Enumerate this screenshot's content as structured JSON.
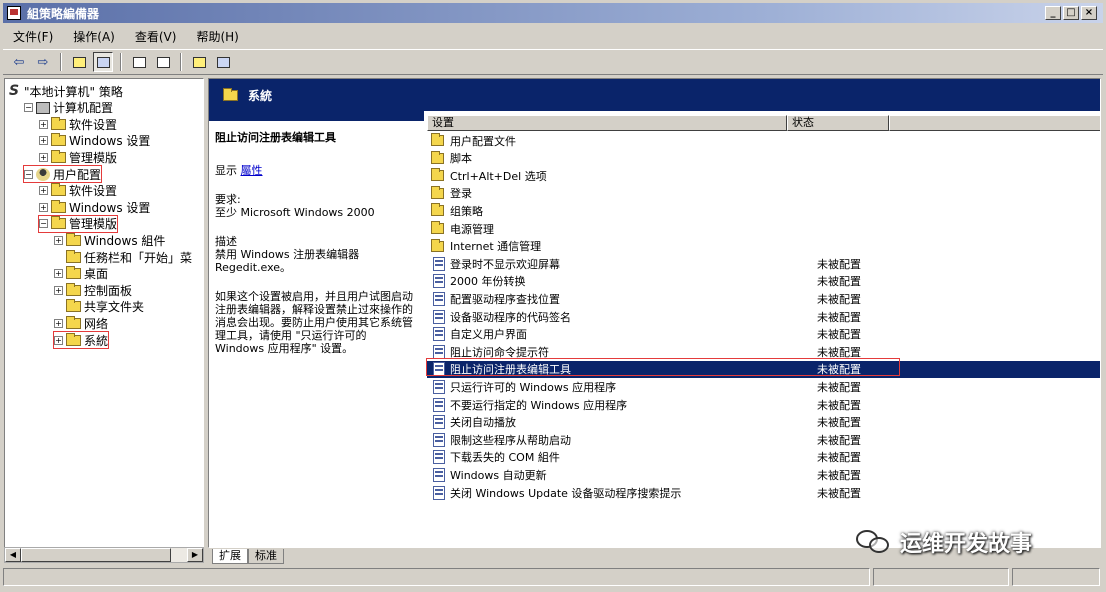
{
  "window": {
    "title": "組策略編備器",
    "controls": [
      "_",
      "□",
      "×"
    ]
  },
  "menubar": [
    "文件(F)",
    "操作(A)",
    "查看(V)",
    "帮助(H)"
  ],
  "toolbar": [
    "back-arrow-icon",
    "forward-arrow-icon",
    "up-folder-icon",
    "show-hide-tree-icon",
    "properties-icon",
    "export-list-icon",
    "help-icon",
    "console-icon"
  ],
  "tree": [
    {
      "label": "\"本地计算机\" 策略",
      "depth": 0,
      "icon": "policy"
    },
    {
      "label": "计算机配置",
      "depth": 1,
      "icon": "computer",
      "pm": "−"
    },
    {
      "label": "软件设置",
      "depth": 2,
      "icon": "folder",
      "pm": "+"
    },
    {
      "label": "Windows 设置",
      "depth": 2,
      "icon": "folder",
      "pm": "+"
    },
    {
      "label": "管理模版",
      "depth": 2,
      "icon": "folder",
      "pm": "+"
    },
    {
      "label": "用户配置",
      "depth": 1,
      "icon": "user",
      "pm": "−"
    },
    {
      "label": "软件设置",
      "depth": 2,
      "icon": "folder",
      "pm": "+"
    },
    {
      "label": "Windows 设置",
      "depth": 2,
      "icon": "folder",
      "pm": "+"
    },
    {
      "label": "管理模版",
      "depth": 2,
      "icon": "folder",
      "pm": "−"
    },
    {
      "label": "Windows 組件",
      "depth": 3,
      "icon": "folder",
      "pm": "+"
    },
    {
      "label": "任務栏和「开始」菜",
      "depth": 3,
      "icon": "folder",
      "pm": ""
    },
    {
      "label": "桌面",
      "depth": 3,
      "icon": "folder",
      "pm": "+"
    },
    {
      "label": "控制面板",
      "depth": 3,
      "icon": "folder",
      "pm": "+"
    },
    {
      "label": "共享文件夹",
      "depth": 3,
      "icon": "folder",
      "pm": ""
    },
    {
      "label": "网络",
      "depth": 3,
      "icon": "folder",
      "pm": "+"
    },
    {
      "label": "系統",
      "depth": 3,
      "icon": "folder",
      "pm": "+"
    }
  ],
  "right": {
    "header_title": "系統",
    "desc": {
      "title": "阻止访问注册表编辑工具",
      "show_label": "显示",
      "show_link": "屬性",
      "req_label": "要求:",
      "req_value": "至少 Microsoft Windows 2000",
      "desc_label": "描述",
      "desc_value": "禁用 Windows 注册表编辑器 Regedit.exe。",
      "body": "如果这个设置被启用，并且用户试图启动注册表编辑器，解释设置禁止过來操作的消息会出现。要防止用户使用其它系统管理工具，请使用 \"只运行许可的 Windows 应用程序\" 设置。"
    },
    "columns": [
      "设置",
      "状态"
    ],
    "rows": [
      {
        "name": "用户配置文件",
        "status": "",
        "type": "folder"
      },
      {
        "name": "脚本",
        "status": "",
        "type": "folder"
      },
      {
        "name": "Ctrl+Alt+Del 选项",
        "status": "",
        "type": "folder"
      },
      {
        "name": "登录",
        "status": "",
        "type": "folder"
      },
      {
        "name": "组策略",
        "status": "",
        "type": "folder"
      },
      {
        "name": "电源管理",
        "status": "",
        "type": "folder"
      },
      {
        "name": "Internet 通信管理",
        "status": "",
        "type": "folder"
      },
      {
        "name": "登录时不显示欢迎屏幕",
        "status": "未被配置",
        "type": "setting"
      },
      {
        "name": "2000 年份转换",
        "status": "未被配置",
        "type": "setting"
      },
      {
        "name": "配置驱动程序查找位置",
        "status": "未被配置",
        "type": "setting"
      },
      {
        "name": "设备驱动程序的代码签名",
        "status": "未被配置",
        "type": "setting"
      },
      {
        "name": "自定义用户界面",
        "status": "未被配置",
        "type": "setting"
      },
      {
        "name": "阻止访问命令提示符",
        "status": "未被配置",
        "type": "setting"
      },
      {
        "name": "阻止访问注册表编辑工具",
        "status": "未被配置",
        "type": "setting",
        "selected": true
      },
      {
        "name": "只运行许可的 Windows 应用程序",
        "status": "未被配置",
        "type": "setting"
      },
      {
        "name": "不要运行指定的 Windows 应用程序",
        "status": "未被配置",
        "type": "setting"
      },
      {
        "name": "关闭自动播放",
        "status": "未被配置",
        "type": "setting"
      },
      {
        "name": "限制这些程序从帮助启动",
        "status": "未被配置",
        "type": "setting"
      },
      {
        "name": "下载丢失的 COM 組件",
        "status": "未被配置",
        "type": "setting"
      },
      {
        "name": "Windows 自动更新",
        "status": "未被配置",
        "type": "setting"
      },
      {
        "name": "关闭 Windows Update 设备驱动程序搜索提示",
        "status": "未被配置",
        "type": "setting"
      }
    ]
  },
  "tabs": [
    "扩展",
    "标准"
  ],
  "watermark": "运维开发故事"
}
